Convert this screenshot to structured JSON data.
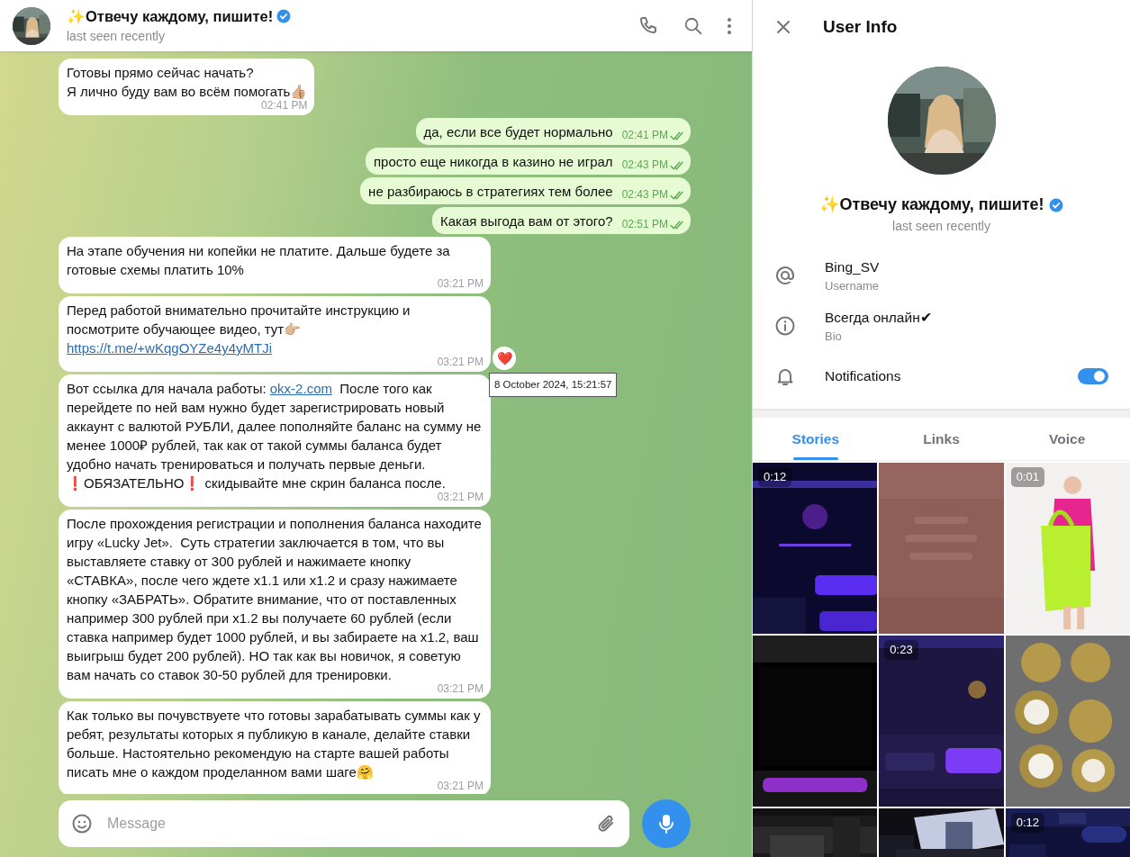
{
  "chat_header": {
    "title": "✨Отвечу каждому, пишите!",
    "verified": true,
    "status": "last seen recently"
  },
  "messages": [
    {
      "kind": "in",
      "segments": [
        {
          "kind": "text",
          "text": "Готовы прямо сейчас начать?\nЯ лично буду вам во всём помогать👍🏼"
        }
      ],
      "time": "02:41 PM"
    },
    {
      "kind": "out",
      "segments": [
        {
          "kind": "text",
          "text": "да, если все будет нормально"
        }
      ],
      "time": "02:41 PM",
      "read": true
    },
    {
      "kind": "out",
      "segments": [
        {
          "kind": "text",
          "text": "просто еще никогда в казино не играл"
        }
      ],
      "time": "02:43 PM",
      "read": true
    },
    {
      "kind": "out",
      "segments": [
        {
          "kind": "text",
          "text": "не разбираюсь в стратегиях тем более"
        }
      ],
      "time": "02:43 PM",
      "read": true
    },
    {
      "kind": "out",
      "segments": [
        {
          "kind": "text",
          "text": "Какая выгода вам от этого?"
        }
      ],
      "time": "02:51 PM",
      "read": true
    },
    {
      "kind": "in",
      "segments": [
        {
          "kind": "text",
          "text": "На этапе обучения ни копейки не платите. Дальше будете за готовые схемы платить 10%"
        }
      ],
      "time": "03:21 PM"
    },
    {
      "kind": "in",
      "segments": [
        {
          "kind": "text",
          "text": "Перед работой внимательно прочитайте инструкцию и посмотрите обучающее видео, тут👉🏼\n"
        },
        {
          "kind": "link",
          "text": "https://t.me/+wKqgOYZe4y4yMTJi"
        }
      ],
      "time": "03:21 PM",
      "reaction": "❤️",
      "tooltip": "8 October 2024, 15:21:57"
    },
    {
      "kind": "in",
      "segments": [
        {
          "kind": "text",
          "text": "Вот ссылка для начала работы: "
        },
        {
          "kind": "link",
          "text": "okx-2.com"
        },
        {
          "kind": "text",
          "text": "  После того как перейдете по ней вам нужно будет зарегистрировать новый аккаунт с валютой РУБЛИ, далее пополняйте баланс на сумму не менее 1000₽ рублей, так как от такой суммы баланса будет удобно начать тренироваться и получать первые деньги.  ❗ОБЯЗАТЕЛЬНО❗ скидывайте мне скрин баланса после."
        }
      ],
      "time": "03:21 PM"
    },
    {
      "kind": "in",
      "segments": [
        {
          "kind": "text",
          "text": "После прохождения регистрации и пополнения баланса находите игру «Lucky Jet».  Суть стратегии заключается в том, что вы выставляете ставку от 300 рублей и нажимаете кнопку «СТАВКА», после чего ждете x1.1 или x1.2 и сразу нажимаете кнопку «ЗАБРАТЬ». Обратите внимание, что от поставленных например 300 рублей при x1.2 вы получаете 60 рублей (если ставка например будет 1000 рублей, и вы забираете на x1.2, ваш выигрыш будет 200 рублей). НО так как вы новичок, я советую вам начать со ставок 30-50 рублей для тренировки."
        }
      ],
      "time": "03:21 PM"
    },
    {
      "kind": "in",
      "segments": [
        {
          "kind": "text",
          "text": "Как только вы почувствуете что готовы зарабатывать суммы как у ребят, результаты которых я публикую в канале, делайте ставки больше. Настоятельно рекомендую на старте вашей работы писать мне о каждом проделанном вами шаге🤗"
        }
      ],
      "time": "03:21 PM"
    }
  ],
  "composer": {
    "placeholder": "Message"
  },
  "user_info": {
    "title": "User Info",
    "name": "✨Отвечу каждому, пишите!",
    "verified": true,
    "status": "last seen recently",
    "rows": [
      {
        "kind": "username",
        "value": "Bing_SV",
        "label": "Username"
      },
      {
        "kind": "bio",
        "value": "Всегда онлайн✔",
        "label": "Bio"
      },
      {
        "kind": "notifications",
        "value": "Notifications",
        "on": true
      }
    ],
    "tabs": [
      {
        "label": "Stories",
        "selected": true
      },
      {
        "label": "Links",
        "selected": false
      },
      {
        "label": "Voice",
        "selected": false
      }
    ],
    "stories": [
      {
        "kind": "picture",
        "duration": "0:12"
      },
      {
        "kind": "picture"
      },
      {
        "kind": "picture",
        "duration": "0:01"
      },
      {
        "kind": "picture"
      },
      {
        "kind": "picture",
        "duration": "0:23"
      },
      {
        "kind": "picture"
      },
      {
        "kind": "picture"
      },
      {
        "kind": "picture"
      },
      {
        "kind": "picture",
        "duration": "0:12"
      }
    ]
  }
}
